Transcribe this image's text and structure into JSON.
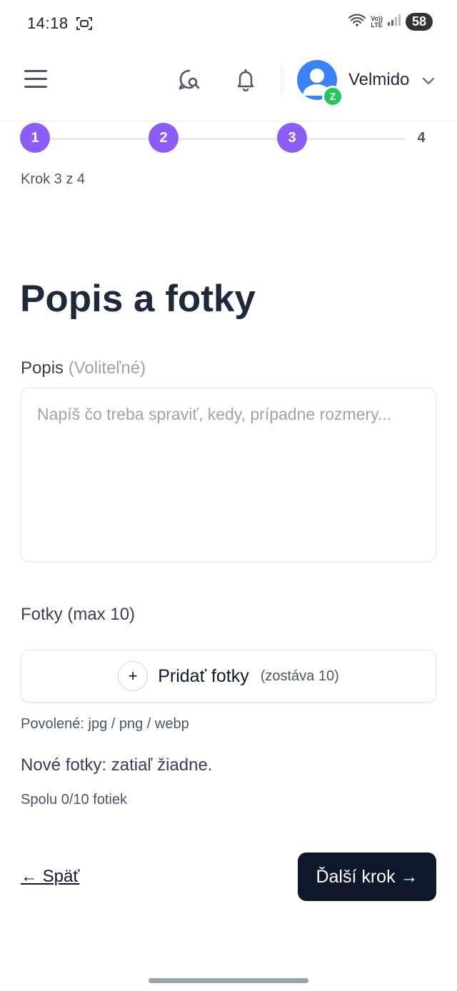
{
  "status_bar": {
    "time": "14:18",
    "volte_top": "Vo))",
    "volte_bottom": "LTE",
    "battery": "58"
  },
  "header": {
    "username": "Velmido",
    "avatar_badge": "Z",
    "colors": {
      "avatar": "#3b82f6",
      "badge": "#22c55e"
    }
  },
  "stepper": {
    "steps": [
      "1",
      "2",
      "3",
      "4"
    ],
    "current": 3,
    "total": 4,
    "caption": "Krok 3 z 4",
    "active_color": "#8b5cf6"
  },
  "main": {
    "title": "Popis a fotky",
    "description": {
      "label": "Popis",
      "optional": "(Voliteľné)",
      "placeholder": "Napíš čo treba spraviť, kedy, prípadne rozmery...",
      "value": ""
    },
    "photos": {
      "label": "Fotky (max 10)",
      "add_button": "Pridať fotky",
      "plus": "+",
      "remaining": "(zostáva 10)",
      "allowed": "Povolené: jpg / png / webp",
      "new_photos": "Nové fotky: zatiaľ žiadne.",
      "total": "Spolu 0/10 fotiek"
    }
  },
  "footer": {
    "back_label": "← Späť",
    "next_label": "Ďalší krok →",
    "next_color": "#0f172a"
  }
}
